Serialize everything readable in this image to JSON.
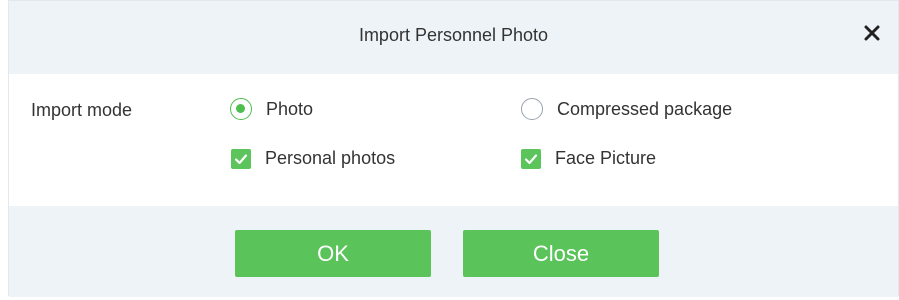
{
  "dialog": {
    "title": "Import Personnel Photo",
    "close_icon": "close-icon"
  },
  "import_mode": {
    "label": "Import mode",
    "options": [
      {
        "label": "Photo",
        "type": "radio",
        "selected": true
      },
      {
        "label": "Compressed package",
        "type": "radio",
        "selected": false
      }
    ],
    "checkboxes": [
      {
        "label": "Personal photos",
        "checked": true
      },
      {
        "label": "Face Picture",
        "checked": true
      }
    ]
  },
  "buttons": {
    "ok_label": "OK",
    "close_label": "Close"
  },
  "colors": {
    "accent": "#5ac35a",
    "header_bg": "#eef3f8"
  }
}
